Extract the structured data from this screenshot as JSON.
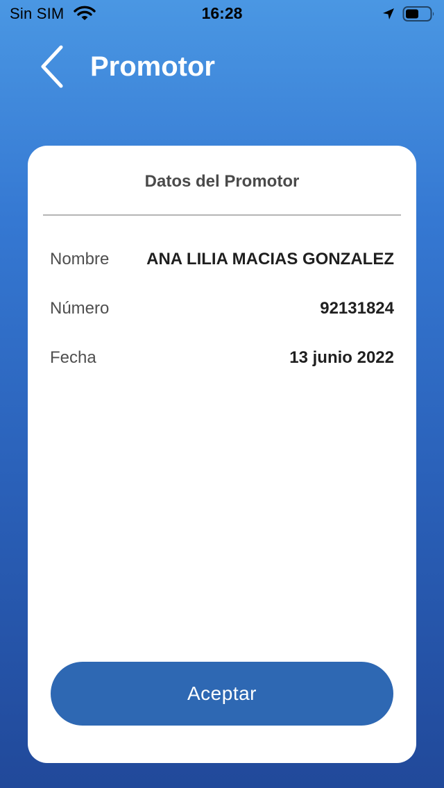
{
  "status_bar": {
    "carrier": "Sin SIM",
    "time": "16:28",
    "icons": [
      "wifi-icon",
      "location-arrow-icon",
      "battery-icon"
    ]
  },
  "nav": {
    "title": "Promotor",
    "back_icon": "chevron-left-icon"
  },
  "card": {
    "header": "Datos del Promotor",
    "rows": [
      {
        "label": "Nombre",
        "value": "ANA LILIA MACIAS GONZALEZ"
      },
      {
        "label": "Número",
        "value": "92131824"
      },
      {
        "label": "Fecha",
        "value": "13 junio 2022"
      }
    ],
    "accept_label": "Aceptar"
  },
  "colors": {
    "background_top": "#4a97e3",
    "background_bottom": "#21499a",
    "button": "#2e68b3",
    "card": "#ffffff"
  }
}
